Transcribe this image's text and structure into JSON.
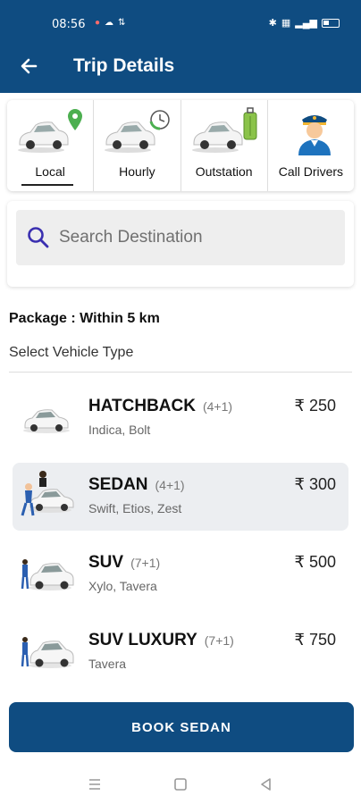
{
  "status_bar": {
    "time": "08:56",
    "left_icons": [
      "sim-icon",
      "cloud-icon",
      "data-icon"
    ],
    "right_icons": [
      "bluetooth-icon",
      "hd-icon",
      "signal-icon",
      "battery-icon"
    ]
  },
  "app_bar": {
    "title": "Trip Details",
    "back_icon": "arrow-left-icon"
  },
  "trip_tabs": [
    {
      "label": "Local",
      "icon": "car-location-pin",
      "active": true
    },
    {
      "label": "Hourly",
      "icon": "car-clock",
      "active": false
    },
    {
      "label": "Outstation",
      "icon": "car-luggage",
      "active": false
    },
    {
      "label": "Call Drivers",
      "icon": "driver-cap",
      "active": false
    }
  ],
  "search": {
    "placeholder": "Search Destination",
    "value": ""
  },
  "package_label": "Package : Within 5 km",
  "select_label": "Select Vehicle Type",
  "vehicles": [
    {
      "name": "HATCHBACK",
      "capacity": "(4+1)",
      "models": "Indica, Bolt",
      "price": "₹ 250",
      "selected": false
    },
    {
      "name": "SEDAN",
      "capacity": "(4+1)",
      "models": "Swift, Etios, Zest",
      "price": "₹ 300",
      "selected": true
    },
    {
      "name": "SUV",
      "capacity": "(7+1)",
      "models": "Xylo, Tavera",
      "price": "₹ 500",
      "selected": false
    },
    {
      "name": "SUV LUXURY",
      "capacity": "(7+1)",
      "models": "Tavera",
      "price": "₹ 750",
      "selected": false
    }
  ],
  "book_button": "BOOK SEDAN",
  "nav_bar": [
    "menu-icon",
    "home-square-icon",
    "back-triangle-icon"
  ],
  "colors": {
    "primary": "#0f4c81",
    "selected_row": "#eceef1",
    "search_icon": "#3a2fb0",
    "pin_green": "#4caf50"
  }
}
